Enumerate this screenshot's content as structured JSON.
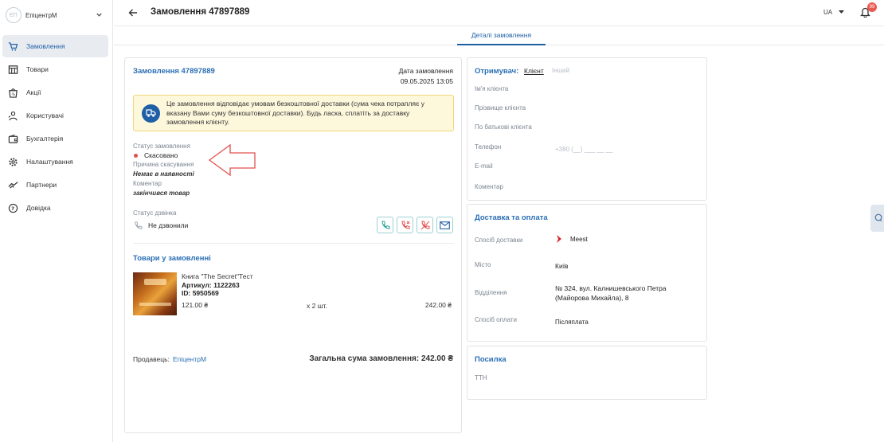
{
  "sidebar": {
    "shop_initials": "ЕП",
    "shop_name": "ЕпіцентрМ",
    "items": [
      {
        "label": "Замовлення",
        "icon": "cart-icon",
        "active": true
      },
      {
        "label": "Товари",
        "icon": "store-icon"
      },
      {
        "label": "Акції",
        "icon": "promo-bag-icon"
      },
      {
        "label": "Користувачі",
        "icon": "users-icon"
      },
      {
        "label": "Бухгалтерія",
        "icon": "wallet-icon"
      },
      {
        "label": "Налаштування",
        "icon": "gear-icon"
      },
      {
        "label": "Партнери",
        "icon": "handshake-icon"
      },
      {
        "label": "Довідка",
        "icon": "help-icon"
      }
    ]
  },
  "header": {
    "title": "Замовлення 47897889",
    "lang": "UA",
    "notifications": "99"
  },
  "tabs": [
    {
      "label": "Деталі замовлення",
      "active": true
    }
  ],
  "order": {
    "title": "Замовлення 47897889",
    "date_label": "Дата замовлення",
    "date_value": "09.05.2025 13:05",
    "notice": "Це замовлення відповідає умовам безкоштовної доставки (сума чека потрапляє у вказану Вами суму безкоштовної доставки). Будь ласка, сплатіть за доставку замовлення клієнту.",
    "status_label": "Статус замовлення",
    "status_value": "Скасовано",
    "status_color": "#e2504d",
    "cancel_reason_label": "Причина скасування",
    "cancel_reason_value": "Немає в наявності",
    "comment_label": "Коментар",
    "comment_value": "закінчився товар",
    "call_status_label": "Статус дзвінка",
    "call_status_value": "Не дзвонили",
    "goods_title": "Товари у замовленні",
    "product": {
      "name": "Книга \"The Secret\"Тест",
      "sku": "Артикул: 1122263",
      "id": "ID: 5950569",
      "price": "121.00 ₴",
      "qty": "x 2 шт.",
      "total": "242.00 ₴"
    },
    "seller_label": "Продавець:",
    "seller_name": "ЕпіцентрМ",
    "grand_total": "Загальна сума замовлення: 242.00 ₴"
  },
  "recipient": {
    "title": "Отримувач:",
    "option_client": "Клієнт",
    "option_other": "Інший",
    "first_name": "Ім'я клієнта",
    "last_name": "Прізвище клієнта",
    "patronymic": "По батькові клієнта",
    "phone_label": "Телефон",
    "phone_placeholder": "+380 (__) ___ __ __",
    "email_label": "E-mail",
    "comment_label": "Коментар"
  },
  "delivery": {
    "title": "Доставка та оплата",
    "method_label": "Спосіб доставки",
    "method_value": "Meest",
    "city_label": "Місто",
    "city_value": "Київ",
    "branch_label": "Відділення",
    "branch_value": "№ 324, вул. Калнишевського Петра (Майорова Михайла), 8",
    "payment_label": "Спосіб оплати",
    "payment_value": "Післяплата"
  },
  "parcel": {
    "title": "Посилка",
    "ttn_label": "ТТН"
  },
  "colors": {
    "accent": "#2a6fb5",
    "notice_bg": "#fdf7dc",
    "notice_border": "#efd77a",
    "call_border": "#9ed0d5",
    "arrow": "#e2504d"
  }
}
